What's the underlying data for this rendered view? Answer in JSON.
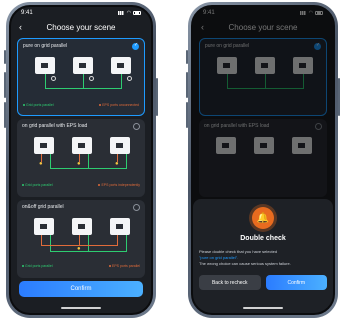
{
  "status": {
    "time": "9:41"
  },
  "header": {
    "title": "Choose your scene",
    "back_icon": "chevron-left-icon"
  },
  "scenes": [
    {
      "label": "pure on grid parallel",
      "selected": true,
      "legend": {
        "green": "Grid ports parallel",
        "orange": "EPS ports unconnected"
      }
    },
    {
      "label": "on grid parallel with EPS load",
      "selected": false,
      "legend": {
        "green": "Grid ports parallel",
        "orange": "EPS ports independently"
      }
    },
    {
      "label": "on&off grid parallel",
      "selected": false,
      "legend": {
        "green": "Grid ports parallel",
        "orange": "EPS ports parallel"
      }
    }
  ],
  "confirm_label": "Confirm",
  "dialog": {
    "title": "Double check",
    "msg_prefix": "Please double check that you have selected",
    "selected_scene": "\"pure on grid parallel\".",
    "warning": "The wrong choice can cause serious system failure.",
    "back_label": "Back to recheck",
    "confirm_label": "Confirm"
  },
  "colors": {
    "accent": "#1e9bff",
    "grid_wire": "#2ecc71",
    "eps_wire": "#e06b3a",
    "warning": "#e86b1f"
  }
}
